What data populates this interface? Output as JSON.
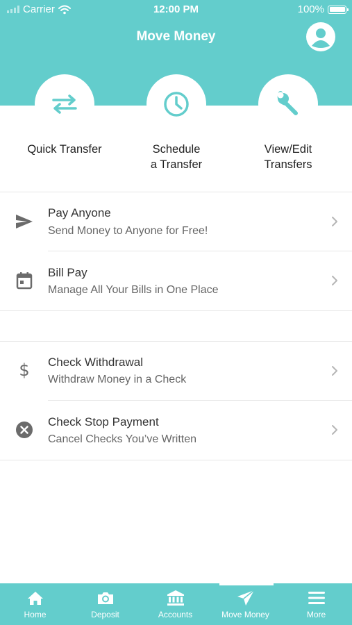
{
  "status_bar": {
    "carrier": "Carrier",
    "time": "12:00 PM",
    "battery": "100%"
  },
  "header": {
    "title": "Move Money",
    "profile_icon": "person-icon"
  },
  "quick_actions": [
    {
      "label_line1": "Quick Transfer",
      "label_line2": "",
      "icon": "swap-arrows-icon"
    },
    {
      "label_line1": "Schedule",
      "label_line2": "a Transfer",
      "icon": "clock-icon"
    },
    {
      "label_line1": "View/Edit",
      "label_line2": "Transfers",
      "icon": "wrench-icon"
    }
  ],
  "groups": [
    {
      "items": [
        {
          "title": "Pay Anyone",
          "subtitle": "Send Money to Anyone for Free!",
          "icon": "send-icon"
        },
        {
          "title": "Bill Pay",
          "subtitle": "Manage All Your Bills in One Place",
          "icon": "calendar-icon"
        }
      ]
    },
    {
      "items": [
        {
          "title": "Check Withdrawal",
          "subtitle": "Withdraw Money in a Check",
          "icon": "dollar-icon"
        },
        {
          "title": "Check Stop Payment",
          "subtitle": "Cancel Checks You’ve Written",
          "icon": "cancel-circle-icon"
        }
      ]
    }
  ],
  "tabbar": {
    "active": "Move Money",
    "tabs": [
      {
        "label": "Home",
        "icon": "home-icon"
      },
      {
        "label": "Deposit",
        "icon": "camera-icon"
      },
      {
        "label": "Accounts",
        "icon": "bank-icon"
      },
      {
        "label": "Move Money",
        "icon": "paper-plane-icon"
      },
      {
        "label": "More",
        "icon": "menu-icon"
      }
    ]
  },
  "colors": {
    "brand": "#63cdcc",
    "icon_gray": "#6b6b6b",
    "chevron": "#b5b5b5"
  }
}
